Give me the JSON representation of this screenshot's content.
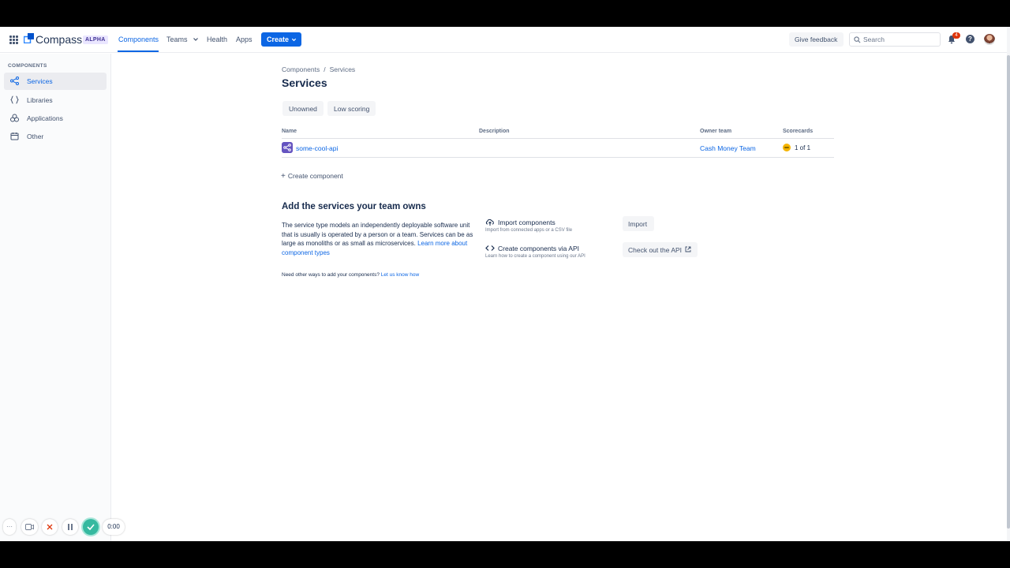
{
  "nav": {
    "logo_text": "Compass",
    "badge": "ALPHA",
    "items": [
      {
        "label": "Components",
        "active": true
      },
      {
        "label": "Teams"
      },
      {
        "label": "Health"
      },
      {
        "label": "Apps"
      }
    ],
    "create_label": "Create",
    "feedback_label": "Give feedback",
    "search_placeholder": "Search",
    "notification_count": "4",
    "help_glyph": "?"
  },
  "sidebar": {
    "heading": "COMPONENTS",
    "items": [
      {
        "label": "Services",
        "icon": "services-icon",
        "active": true
      },
      {
        "label": "Libraries",
        "icon": "libraries-icon"
      },
      {
        "label": "Applications",
        "icon": "applications-icon"
      },
      {
        "label": "Other",
        "icon": "other-icon"
      }
    ]
  },
  "main": {
    "breadcrumb": [
      "Components",
      "Services"
    ],
    "title": "Services",
    "filters": [
      "Unowned",
      "Low scoring"
    ],
    "table": {
      "headers": [
        "Name",
        "Description",
        "Owner team",
        "Scorecards"
      ],
      "rows": [
        {
          "name": "some-cool-api",
          "description": "",
          "owner": "Cash Money Team",
          "scorecards": "1 of 1"
        }
      ]
    },
    "create_component": "Create component",
    "empty_section": {
      "title": "Add the services your team owns",
      "description": "The service type models an independently deployable software unit that is usually is operated by a person or a team. Services can be as large as monoliths or as small as microservices.",
      "learn_more": "Learn more about component types",
      "other_ways_text": "Need other ways to add your components?",
      "other_ways_link": "Let us know how",
      "options": [
        {
          "title": "Import components",
          "subtitle": "Import from connected apps or a CSV file",
          "button": "Import"
        },
        {
          "title": "Create components via API",
          "subtitle": "Learn how to create a component using our API",
          "button": "Check out the API"
        }
      ]
    }
  },
  "recorder": {
    "more": "···",
    "time": "0:00"
  },
  "colors": {
    "accent": "#0c66e4",
    "service_icon": "#6554c0",
    "score_dot": "#f5b400",
    "recorder_check": "#36b9a0"
  }
}
